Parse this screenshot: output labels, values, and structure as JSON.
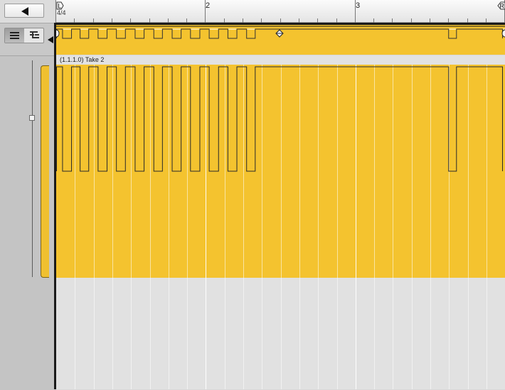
{
  "ruler": {
    "signature": "4/4",
    "bars": [
      {
        "label": "2",
        "beat": 4
      },
      {
        "label": "3",
        "beat": 8
      }
    ],
    "left_locator": "L",
    "right_locator": "R"
  },
  "region": {
    "label": "(1.1.1.0) Take 2",
    "color": "#f4c32f"
  },
  "automation": {
    "pulses": [
      {
        "start": 0.0,
        "end": 0.16
      },
      {
        "start": 0.4,
        "end": 0.63
      },
      {
        "start": 0.86,
        "end": 1.11
      },
      {
        "start": 1.35,
        "end": 1.6
      },
      {
        "start": 1.84,
        "end": 2.1
      },
      {
        "start": 2.34,
        "end": 2.6
      },
      {
        "start": 2.83,
        "end": 3.09
      },
      {
        "start": 3.33,
        "end": 3.58
      },
      {
        "start": 3.83,
        "end": 4.08
      },
      {
        "start": 4.33,
        "end": 4.58
      },
      {
        "start": 4.82,
        "end": 5.08
      },
      {
        "start": 5.31,
        "end": 10.48
      },
      {
        "start": 10.69,
        "end": 11.92
      }
    ],
    "end_beat": 11.92,
    "low_value": 0.0,
    "high_value": 1.0
  },
  "toolbar": {
    "back_icon": "left-arrow-icon",
    "view_icons": [
      "list-view-icon",
      "tree-view-icon"
    ]
  }
}
